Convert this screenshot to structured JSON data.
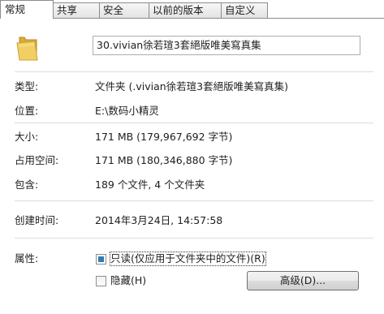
{
  "tabs": [
    {
      "label": "常规",
      "active": true
    },
    {
      "label": "共享",
      "active": false
    },
    {
      "label": "安全",
      "active": false
    },
    {
      "label": "以前的版本",
      "active": false
    },
    {
      "label": "自定义",
      "active": false
    }
  ],
  "folder": {
    "icon": "folder-icon",
    "icon_color": "#e8c14d",
    "name": "30.vivian徐若瑄3套絕版唯美寫真集"
  },
  "properties": {
    "type": {
      "label": "类型:",
      "value": "文件夹 (.vivian徐若瑄3套絕版唯美寫真集)"
    },
    "location": {
      "label": "位置:",
      "value": "E:\\数码小精灵"
    },
    "size": {
      "label": "大小:",
      "value": "171 MB (179,967,692 字节)"
    },
    "size_on_disk": {
      "label": "占用空间:",
      "value": "171 MB (180,346,880 字节)"
    },
    "contains": {
      "label": "包含:",
      "value": "189 个文件, 4 个文件夹"
    },
    "created": {
      "label": "创建时间:",
      "value": "2014年3月24日, 14:57:58"
    }
  },
  "attributes": {
    "label": "属性:",
    "readonly": {
      "label": "只读(仅应用于文件夹中的文件)(R)",
      "checked": true
    },
    "hidden": {
      "label": "隐藏(H)",
      "checked": false
    },
    "advanced_button": "高级(D)..."
  }
}
